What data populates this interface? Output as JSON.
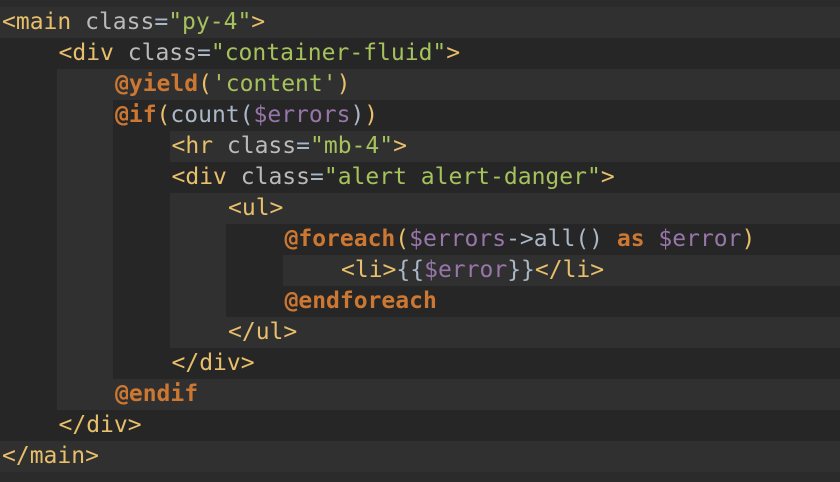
{
  "theme": {
    "background": "#2b2b2b",
    "band_dark": "#262626",
    "band_light": "#303030",
    "tag_color": "#e8bf6a",
    "string_color": "#a5c25c",
    "directive_color": "#cc7832",
    "variable_color": "#9876aa",
    "text_color": "#a9b7c6"
  },
  "lines": [
    {
      "indent": 0,
      "tokens": [
        [
          "tag",
          "<main "
        ],
        [
          "attr",
          "class"
        ],
        [
          "plain",
          "="
        ],
        [
          "str",
          "\"py-4\""
        ],
        [
          "tag",
          ">"
        ]
      ]
    },
    {
      "indent": 1,
      "tokens": [
        [
          "tag",
          "<div "
        ],
        [
          "attr",
          "class"
        ],
        [
          "plain",
          "="
        ],
        [
          "str",
          "\"container-fluid\""
        ],
        [
          "tag",
          ">"
        ]
      ]
    },
    {
      "indent": 2,
      "tokens": [
        [
          "dir",
          "@yield"
        ],
        [
          "paren",
          "("
        ],
        [
          "strsq",
          "'content'"
        ],
        [
          "paren",
          ")"
        ]
      ]
    },
    {
      "indent": 2,
      "tokens": [
        [
          "dir",
          "@if"
        ],
        [
          "paren",
          "("
        ],
        [
          "plain",
          "count("
        ],
        [
          "var",
          "$errors"
        ],
        [
          "plain",
          ")"
        ],
        [
          "paren",
          ")"
        ]
      ]
    },
    {
      "indent": 3,
      "tokens": [
        [
          "tag",
          "<hr "
        ],
        [
          "attr",
          "class"
        ],
        [
          "plain",
          "="
        ],
        [
          "str",
          "\"mb-4\""
        ],
        [
          "tag",
          ">"
        ]
      ]
    },
    {
      "indent": 3,
      "tokens": [
        [
          "tag",
          "<div "
        ],
        [
          "attr",
          "class"
        ],
        [
          "plain",
          "="
        ],
        [
          "str",
          "\"alert alert-danger\""
        ],
        [
          "tag",
          ">"
        ]
      ]
    },
    {
      "indent": 4,
      "tokens": [
        [
          "tag",
          "<ul>"
        ]
      ]
    },
    {
      "indent": 5,
      "tokens": [
        [
          "dir",
          "@foreach"
        ],
        [
          "paren",
          "("
        ],
        [
          "var",
          "$errors"
        ],
        [
          "plain",
          "->all() "
        ],
        [
          "dir",
          "as"
        ],
        [
          "plain",
          " "
        ],
        [
          "var",
          "$error"
        ],
        [
          "paren",
          ")"
        ]
      ]
    },
    {
      "indent": 6,
      "tokens": [
        [
          "tag",
          "<li>"
        ],
        [
          "plain",
          "{{"
        ],
        [
          "var",
          "$error"
        ],
        [
          "plain",
          "}}"
        ],
        [
          "tag",
          "</li>"
        ]
      ]
    },
    {
      "indent": 5,
      "tokens": [
        [
          "dir",
          "@endforeach"
        ]
      ]
    },
    {
      "indent": 4,
      "tokens": [
        [
          "tag",
          "</ul>"
        ]
      ]
    },
    {
      "indent": 3,
      "tokens": [
        [
          "tag",
          "</div>"
        ]
      ]
    },
    {
      "indent": 2,
      "tokens": [
        [
          "dir",
          "@endif"
        ]
      ]
    },
    {
      "indent": 1,
      "tokens": [
        [
          "tag",
          "</div>"
        ]
      ]
    },
    {
      "indent": 0,
      "tokens": [
        [
          "tag",
          "</main>"
        ]
      ]
    }
  ]
}
